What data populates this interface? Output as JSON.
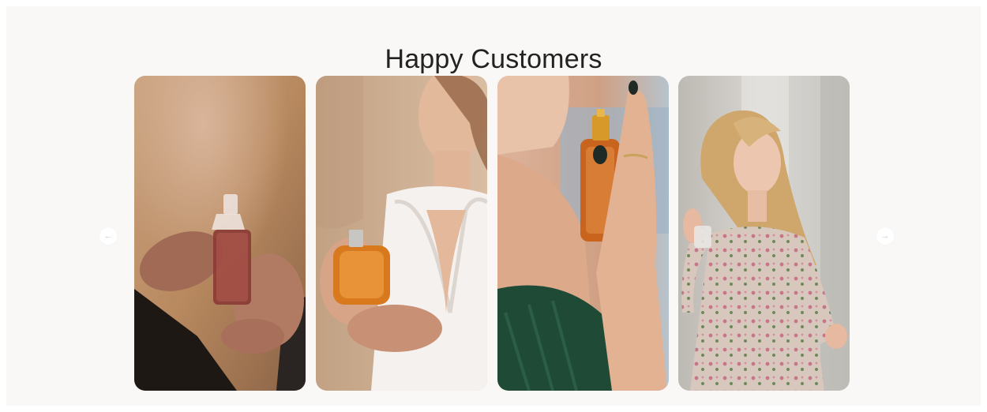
{
  "section": {
    "title": "Happy Customers"
  },
  "carousel": {
    "prev_icon": "arrow-left-icon",
    "next_icon": "arrow-right-icon",
    "prev_glyph": "←",
    "next_glyph": "→",
    "cards": [
      {
        "subject": "hands-holding-perfume-bottle"
      },
      {
        "subject": "bride-spraying-perfume"
      },
      {
        "subject": "woman-spraying-perfume-on-neck"
      },
      {
        "subject": "blonde-woman-floral-dress-perfume"
      }
    ]
  }
}
